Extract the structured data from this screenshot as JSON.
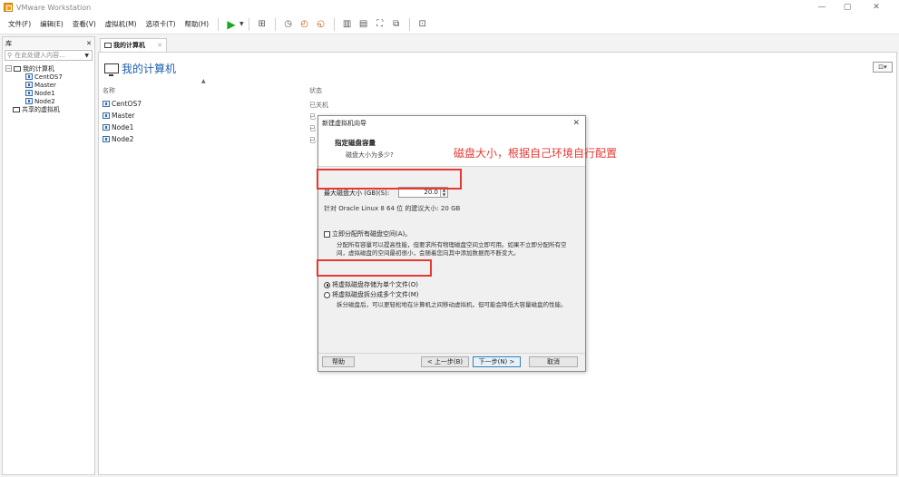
{
  "app": {
    "title": "VMware Workstation"
  },
  "window_controls": {
    "minimize": "—",
    "maximize": "▢",
    "close": "✕"
  },
  "menu": [
    "文件(F)",
    "编辑(E)",
    "查看(V)",
    "虚拟机(M)",
    "选项卡(T)",
    "帮助(H)"
  ],
  "library": {
    "title": "库",
    "close": "✕",
    "search_placeholder": "在此处键入内容...",
    "root": "我的计算机",
    "vms": [
      "CentOS7",
      "Master",
      "Node1",
      "Node2"
    ],
    "shared": "共享的虚拟机"
  },
  "tab": {
    "label": "我的计算机",
    "close": "✕"
  },
  "main": {
    "title": "我的计算机",
    "columns": {
      "name": "名称",
      "status": "状态"
    },
    "vms": [
      {
        "name": "CentOS7",
        "status": "已关机"
      },
      {
        "name": "Master",
        "status": "已"
      },
      {
        "name": "Node1",
        "status": "已"
      },
      {
        "name": "Node2",
        "status": "已"
      }
    ]
  },
  "dialog": {
    "title": "新建虚拟机向导",
    "close": "✕",
    "heading": "指定磁盘容量",
    "subheading": "磁盘大小为多少?",
    "size_label": "最大磁盘大小 (GB)(S):",
    "size_value": "20.0",
    "recommendation": "针对 Oracle Linux 8 64 位 的建议大小: 20 GB",
    "allocate_label": "立即分配所有磁盘空间(A)。",
    "allocate_desc": "分配所有容量可以提高性能，但要求所有物理磁盘空间立即可用。如果不立即分配所有空间，虚拟磁盘的空间最初很小，会随着您向其中添加数据而不断变大。",
    "single_file_label": "将虚拟磁盘存储为单个文件(O)",
    "multi_file_label": "将虚拟磁盘拆分成多个文件(M)",
    "multi_file_desc": "拆分磁盘后，可以更轻松地在计算机之间移动虚拟机，但可能会降低大容量磁盘的性能。",
    "buttons": {
      "help": "帮助",
      "back": "< 上一步(B)",
      "next": "下一步(N) >",
      "cancel": "取消"
    }
  },
  "annotation": "磁盘大小，根据自己环境自行配置",
  "colors": {
    "highlight": "#e53935",
    "title_blue": "#1f5fae"
  }
}
